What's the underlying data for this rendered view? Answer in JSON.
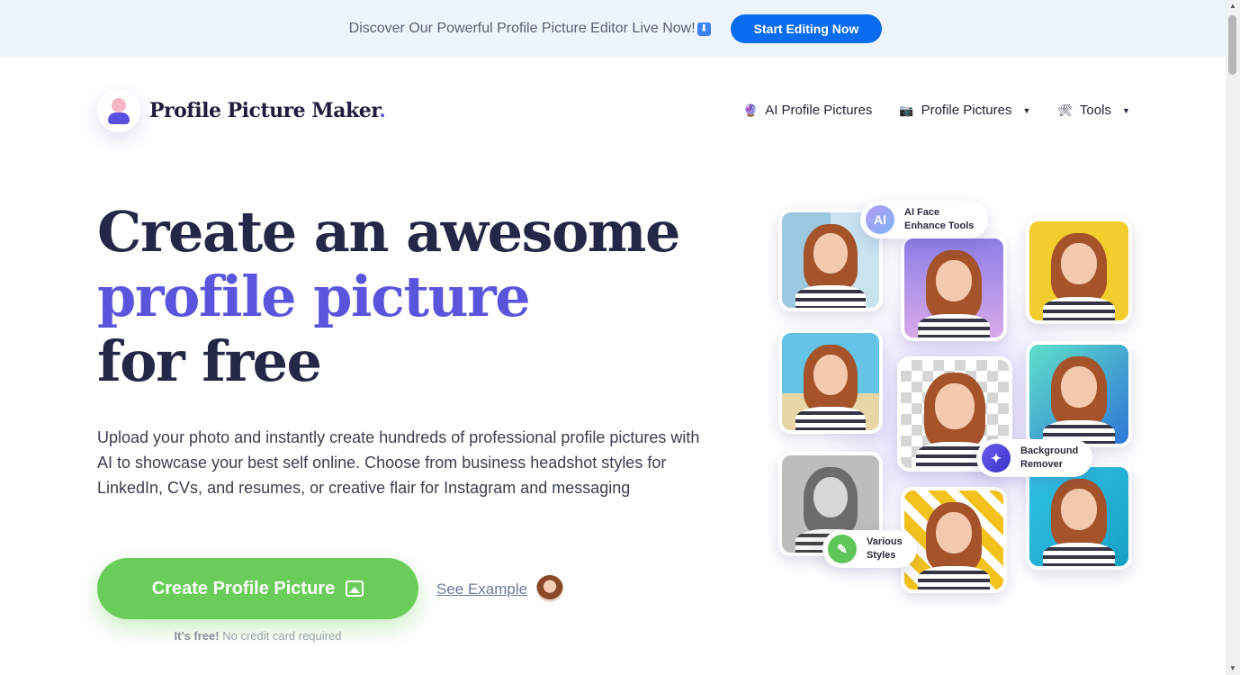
{
  "announcement": {
    "text": "Discover Our Powerful Profile Picture Editor Live Now!",
    "arrow": "⬇",
    "button_label": "Start Editing Now"
  },
  "brand": {
    "name": "Profile Picture Maker",
    "dot": "."
  },
  "nav": {
    "items": [
      {
        "label": "AI Profile Pictures",
        "icon": "🔮"
      },
      {
        "label": "Profile Pictures",
        "icon": "📷",
        "dropdown": true
      },
      {
        "label": "Tools",
        "icon": "🛠",
        "dropdown": true
      }
    ],
    "caret": "▼"
  },
  "hero": {
    "title_line1": "Create an awesome",
    "title_line2": "profile picture",
    "title_line3": "for free",
    "description": "Upload your photo and instantly create hundreds of professional profile pictures with AI to showcase your best self online. Choose from business headshot styles for LinkedIn, CVs, and resumes, or creative flair for Instagram and messaging",
    "cta_label": "Create Profile Picture",
    "see_example": "See Example",
    "free_bold": "It's free!",
    "free_rest": " No credit card required"
  },
  "badges": {
    "ai_icon": "AI",
    "ai_line1": "AI Face",
    "ai_line2": "Enhance Tools",
    "bg_line1": "Background",
    "bg_line2": "Remover",
    "styles_line1": "Various",
    "styles_line2": "Styles"
  },
  "colors": {
    "accent_purple": "#5a55dc",
    "cta_green": "#6acd5a",
    "topbar_button": "#0a6cf0",
    "topbar_bg": "#eef4fc"
  }
}
